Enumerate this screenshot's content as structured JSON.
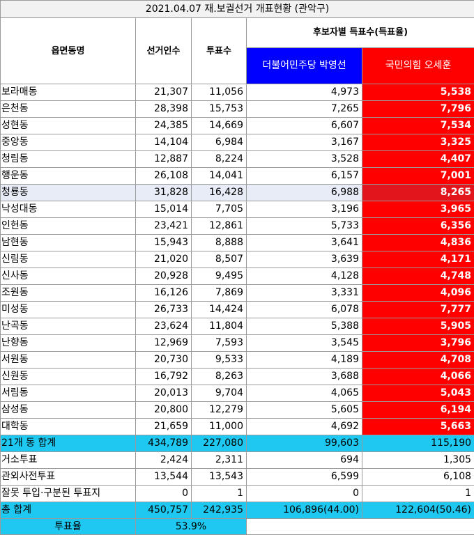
{
  "title": "2021.04.07 재.보궐선거 개표현황 (관악구)",
  "headers": {
    "district": "읍면동명",
    "voters": "선거인수",
    "votes": "투표수",
    "group": "후보자별 득표수(득표율)",
    "cand1": "더불어민주당 박영선",
    "cand2": "국민의힘 오세훈"
  },
  "colors": {
    "cand1": "#0000ff",
    "cand2": "#ff0000",
    "summary": "#1fc8f0"
  },
  "rows": [
    {
      "name": "보라매동",
      "voters": "21,307",
      "votes": "11,056",
      "c1": "4,973",
      "c2": "5,538"
    },
    {
      "name": "은천동",
      "voters": "28,398",
      "votes": "15,753",
      "c1": "7,265",
      "c2": "7,796"
    },
    {
      "name": "성현동",
      "voters": "24,385",
      "votes": "14,669",
      "c1": "6,607",
      "c2": "7,534"
    },
    {
      "name": "중앙동",
      "voters": "14,104",
      "votes": "6,984",
      "c1": "3,167",
      "c2": "3,325"
    },
    {
      "name": "청림동",
      "voters": "12,887",
      "votes": "8,224",
      "c1": "3,528",
      "c2": "4,407"
    },
    {
      "name": "행운동",
      "voters": "26,108",
      "votes": "14,041",
      "c1": "6,157",
      "c2": "7,001"
    },
    {
      "name": "청룡동",
      "voters": "31,828",
      "votes": "16,428",
      "c1": "6,988",
      "c2": "8,265"
    },
    {
      "name": "낙성대동",
      "voters": "15,014",
      "votes": "7,705",
      "c1": "3,196",
      "c2": "3,965"
    },
    {
      "name": "인헌동",
      "voters": "23,421",
      "votes": "12,861",
      "c1": "5,733",
      "c2": "6,356"
    },
    {
      "name": "남현동",
      "voters": "15,943",
      "votes": "8,888",
      "c1": "3,641",
      "c2": "4,836"
    },
    {
      "name": "신림동",
      "voters": "21,020",
      "votes": "8,507",
      "c1": "3,639",
      "c2": "4,171"
    },
    {
      "name": "신사동",
      "voters": "20,928",
      "votes": "9,495",
      "c1": "4,128",
      "c2": "4,748"
    },
    {
      "name": "조원동",
      "voters": "16,126",
      "votes": "7,869",
      "c1": "3,331",
      "c2": "4,096"
    },
    {
      "name": "미성동",
      "voters": "26,733",
      "votes": "14,424",
      "c1": "6,078",
      "c2": "7,777"
    },
    {
      "name": "난곡동",
      "voters": "23,624",
      "votes": "11,804",
      "c1": "5,388",
      "c2": "5,905"
    },
    {
      "name": "난향동",
      "voters": "12,969",
      "votes": "7,593",
      "c1": "3,545",
      "c2": "3,796"
    },
    {
      "name": "서원동",
      "voters": "20,730",
      "votes": "9,533",
      "c1": "4,189",
      "c2": "4,708"
    },
    {
      "name": "신원동",
      "voters": "16,792",
      "votes": "8,263",
      "c1": "3,688",
      "c2": "4,066"
    },
    {
      "name": "서림동",
      "voters": "20,013",
      "votes": "9,704",
      "c1": "4,065",
      "c2": "5,043"
    },
    {
      "name": "삼성동",
      "voters": "20,800",
      "votes": "12,279",
      "c1": "5,605",
      "c2": "6,194"
    },
    {
      "name": "대학동",
      "voters": "21,659",
      "votes": "11,000",
      "c1": "4,692",
      "c2": "5,663"
    }
  ],
  "dong_total": {
    "name": "21개 동 합계",
    "voters": "434,789",
    "votes": "227,080",
    "c1": "99,603",
    "c2": "115,190"
  },
  "extra_rows": [
    {
      "name": "거소투표",
      "voters": "2,424",
      "votes": "2,311",
      "c1": "694",
      "c2": "1,305"
    },
    {
      "name": "관외사전투표",
      "voters": "13,544",
      "votes": "13,543",
      "c1": "6,599",
      "c2": "6,108"
    },
    {
      "name": "잘못 투입·구분된 투표지",
      "voters": "0",
      "votes": "1",
      "c1": "0",
      "c2": "1"
    }
  ],
  "grand_total": {
    "name": "총 합계",
    "voters": "450,757",
    "votes": "242,935",
    "c1": "106,896(44.00)",
    "c2": "122,604(50.46)"
  },
  "turnout": {
    "label": "투표율",
    "value": "53.9%"
  }
}
